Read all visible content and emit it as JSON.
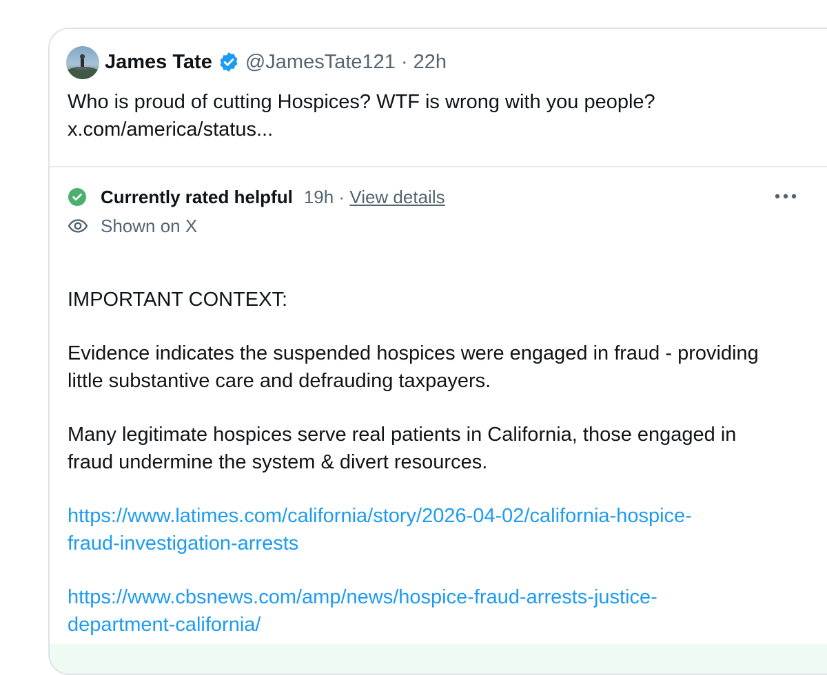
{
  "tweet": {
    "author_name": "James Tate",
    "handle_time": "@JamesTate121 · 22h",
    "text_lines": [
      "Who is proud of cutting Hospices? WTF is wrong with you people?",
      "x.com/america/status..."
    ]
  },
  "note": {
    "rating_label": "Currently rated helpful",
    "rating_time": "19h · ",
    "view_details": "View details",
    "shown_on": "Shown on X",
    "heading": "IMPORTANT CONTEXT:",
    "paragraph1_lines": [
      "Evidence indicates the suspended hospices were engaged in fraud -  providing",
      "little substantive care and defrauding taxpayers."
    ],
    "paragraph2_lines": [
      "Many legitimate hospices serve real patients in California, those engaged in",
      "fraud undermine the system & divert resources."
    ],
    "link1_lines": [
      "https://www.latimes.com/california/story/2026-04-02/california-hospice-",
      "fraud-investigation-arrests"
    ],
    "link2_lines": [
      "https://www.cbsnews.com/amp/news/hospice-fraud-arrests-justice-",
      "department-california/"
    ]
  },
  "icons": {
    "verified": "verified-badge-icon",
    "check": "check-circle-icon",
    "eye": "eye-icon",
    "more": "more-dots-icon"
  },
  "colors": {
    "verified_blue": "#1d9bf0",
    "helpful_green": "#4ab06e",
    "link_blue": "#1d9bf0",
    "secondary_text": "#536471"
  }
}
